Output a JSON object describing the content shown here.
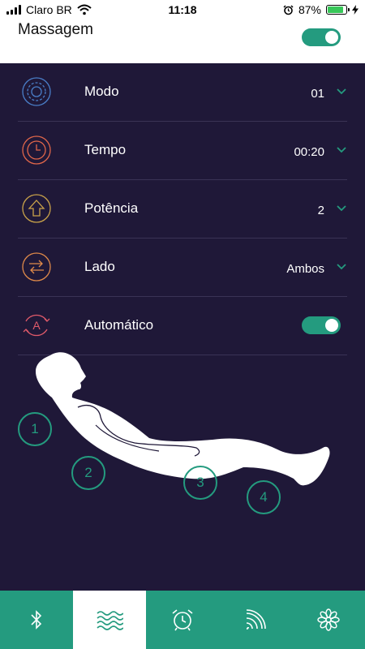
{
  "status_bar": {
    "carrier": "Claro BR",
    "time": "11:18",
    "battery": "87%",
    "battery_level": 0.87
  },
  "header": {
    "title": "Massagem",
    "toggle_on": true
  },
  "settings": [
    {
      "label": "Modo",
      "value": "01",
      "icon": "mode-icon",
      "icon_color": "#4a7fc9"
    },
    {
      "label": "Tempo",
      "value": "00:20",
      "icon": "clock-icon",
      "icon_color": "#e0664a"
    },
    {
      "label": "Potência",
      "value": "2",
      "icon": "arrow-up-icon",
      "icon_color": "#c9a24a"
    },
    {
      "label": "Lado",
      "value": "Ambos",
      "icon": "swap-arrows-icon",
      "icon_color": "#e08a4a"
    },
    {
      "label": "Automático",
      "toggle_on": true,
      "icon": "auto-icon",
      "icon_color": "#e05a6a"
    }
  ],
  "zones": [
    "1",
    "2",
    "3",
    "4"
  ],
  "tabs": [
    {
      "icon": "bluetooth-icon",
      "active": false
    },
    {
      "icon": "waves-icon",
      "active": true
    },
    {
      "icon": "alarm-clock-icon",
      "active": false
    },
    {
      "icon": "signal-icon",
      "active": false
    },
    {
      "icon": "flower-icon",
      "active": false
    }
  ],
  "colors": {
    "background": "#1f1838",
    "accent": "#249b7f",
    "divider": "#3a3355"
  }
}
